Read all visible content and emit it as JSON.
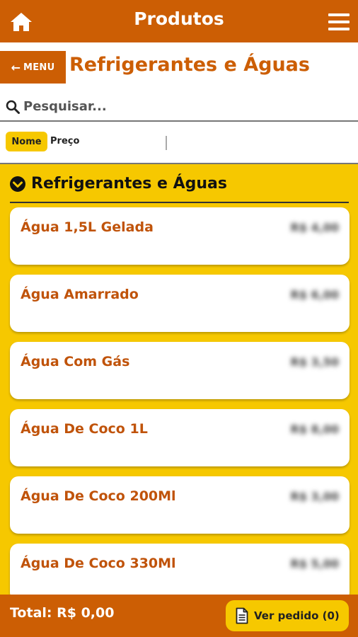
{
  "topbar": {
    "title": "Produtos",
    "home_icon": "home-icon",
    "menu_icon": "hamburger-menu-icon"
  },
  "subheader": {
    "back_label": "MENU",
    "back_arrow": "←",
    "category_title": "Refrigerantes e Águas"
  },
  "search": {
    "placeholder": "Pesquisar...",
    "value": ""
  },
  "sort": {
    "options": [
      "Nome",
      "Preço"
    ],
    "selected": "Nome"
  },
  "section": {
    "title": "Refrigerantes e Águas"
  },
  "products": [
    {
      "name": "Água 1,5L Gelada",
      "price": "R$ 4,00"
    },
    {
      "name": "Água Amarrado",
      "price": "R$ 6,00"
    },
    {
      "name": "Água Com Gás",
      "price": "R$ 3,50"
    },
    {
      "name": "Água De Coco 1L",
      "price": "R$ 8,00"
    },
    {
      "name": "Água De Coco 200Ml",
      "price": "R$ 3,00"
    },
    {
      "name": "Água De Coco 330Ml",
      "price": "R$ 5,00"
    }
  ],
  "bottombar": {
    "total_label": "Total: R$ 0,00",
    "order_button": "Ver pedido (0)"
  },
  "colors": {
    "primary": "#cc5e04",
    "accent": "#f6c800",
    "card": "#ffffff"
  }
}
